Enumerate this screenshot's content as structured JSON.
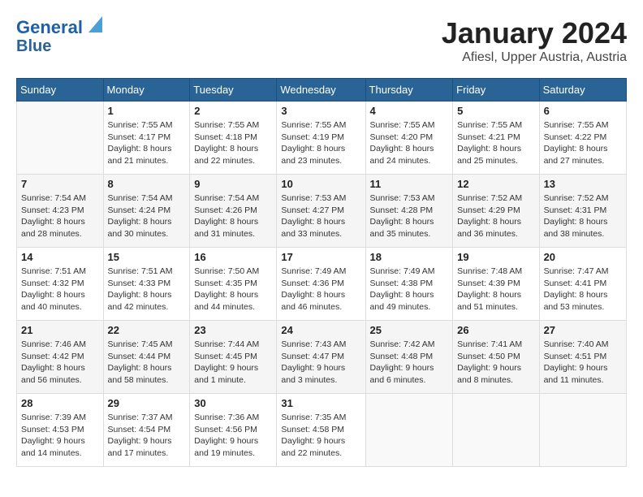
{
  "header": {
    "logo_general": "General",
    "logo_blue": "Blue",
    "month": "January 2024",
    "location": "Afiesl, Upper Austria, Austria"
  },
  "days_of_week": [
    "Sunday",
    "Monday",
    "Tuesday",
    "Wednesday",
    "Thursday",
    "Friday",
    "Saturday"
  ],
  "weeks": [
    [
      {
        "day": "",
        "sunrise": "",
        "sunset": "",
        "daylight": ""
      },
      {
        "day": "1",
        "sunrise": "Sunrise: 7:55 AM",
        "sunset": "Sunset: 4:17 PM",
        "daylight": "Daylight: 8 hours and 21 minutes."
      },
      {
        "day": "2",
        "sunrise": "Sunrise: 7:55 AM",
        "sunset": "Sunset: 4:18 PM",
        "daylight": "Daylight: 8 hours and 22 minutes."
      },
      {
        "day": "3",
        "sunrise": "Sunrise: 7:55 AM",
        "sunset": "Sunset: 4:19 PM",
        "daylight": "Daylight: 8 hours and 23 minutes."
      },
      {
        "day": "4",
        "sunrise": "Sunrise: 7:55 AM",
        "sunset": "Sunset: 4:20 PM",
        "daylight": "Daylight: 8 hours and 24 minutes."
      },
      {
        "day": "5",
        "sunrise": "Sunrise: 7:55 AM",
        "sunset": "Sunset: 4:21 PM",
        "daylight": "Daylight: 8 hours and 25 minutes."
      },
      {
        "day": "6",
        "sunrise": "Sunrise: 7:55 AM",
        "sunset": "Sunset: 4:22 PM",
        "daylight": "Daylight: 8 hours and 27 minutes."
      }
    ],
    [
      {
        "day": "7",
        "sunrise": "Sunrise: 7:54 AM",
        "sunset": "Sunset: 4:23 PM",
        "daylight": "Daylight: 8 hours and 28 minutes."
      },
      {
        "day": "8",
        "sunrise": "Sunrise: 7:54 AM",
        "sunset": "Sunset: 4:24 PM",
        "daylight": "Daylight: 8 hours and 30 minutes."
      },
      {
        "day": "9",
        "sunrise": "Sunrise: 7:54 AM",
        "sunset": "Sunset: 4:26 PM",
        "daylight": "Daylight: 8 hours and 31 minutes."
      },
      {
        "day": "10",
        "sunrise": "Sunrise: 7:53 AM",
        "sunset": "Sunset: 4:27 PM",
        "daylight": "Daylight: 8 hours and 33 minutes."
      },
      {
        "day": "11",
        "sunrise": "Sunrise: 7:53 AM",
        "sunset": "Sunset: 4:28 PM",
        "daylight": "Daylight: 8 hours and 35 minutes."
      },
      {
        "day": "12",
        "sunrise": "Sunrise: 7:52 AM",
        "sunset": "Sunset: 4:29 PM",
        "daylight": "Daylight: 8 hours and 36 minutes."
      },
      {
        "day": "13",
        "sunrise": "Sunrise: 7:52 AM",
        "sunset": "Sunset: 4:31 PM",
        "daylight": "Daylight: 8 hours and 38 minutes."
      }
    ],
    [
      {
        "day": "14",
        "sunrise": "Sunrise: 7:51 AM",
        "sunset": "Sunset: 4:32 PM",
        "daylight": "Daylight: 8 hours and 40 minutes."
      },
      {
        "day": "15",
        "sunrise": "Sunrise: 7:51 AM",
        "sunset": "Sunset: 4:33 PM",
        "daylight": "Daylight: 8 hours and 42 minutes."
      },
      {
        "day": "16",
        "sunrise": "Sunrise: 7:50 AM",
        "sunset": "Sunset: 4:35 PM",
        "daylight": "Daylight: 8 hours and 44 minutes."
      },
      {
        "day": "17",
        "sunrise": "Sunrise: 7:49 AM",
        "sunset": "Sunset: 4:36 PM",
        "daylight": "Daylight: 8 hours and 46 minutes."
      },
      {
        "day": "18",
        "sunrise": "Sunrise: 7:49 AM",
        "sunset": "Sunset: 4:38 PM",
        "daylight": "Daylight: 8 hours and 49 minutes."
      },
      {
        "day": "19",
        "sunrise": "Sunrise: 7:48 AM",
        "sunset": "Sunset: 4:39 PM",
        "daylight": "Daylight: 8 hours and 51 minutes."
      },
      {
        "day": "20",
        "sunrise": "Sunrise: 7:47 AM",
        "sunset": "Sunset: 4:41 PM",
        "daylight": "Daylight: 8 hours and 53 minutes."
      }
    ],
    [
      {
        "day": "21",
        "sunrise": "Sunrise: 7:46 AM",
        "sunset": "Sunset: 4:42 PM",
        "daylight": "Daylight: 8 hours and 56 minutes."
      },
      {
        "day": "22",
        "sunrise": "Sunrise: 7:45 AM",
        "sunset": "Sunset: 4:44 PM",
        "daylight": "Daylight: 8 hours and 58 minutes."
      },
      {
        "day": "23",
        "sunrise": "Sunrise: 7:44 AM",
        "sunset": "Sunset: 4:45 PM",
        "daylight": "Daylight: 9 hours and 1 minute."
      },
      {
        "day": "24",
        "sunrise": "Sunrise: 7:43 AM",
        "sunset": "Sunset: 4:47 PM",
        "daylight": "Daylight: 9 hours and 3 minutes."
      },
      {
        "day": "25",
        "sunrise": "Sunrise: 7:42 AM",
        "sunset": "Sunset: 4:48 PM",
        "daylight": "Daylight: 9 hours and 6 minutes."
      },
      {
        "day": "26",
        "sunrise": "Sunrise: 7:41 AM",
        "sunset": "Sunset: 4:50 PM",
        "daylight": "Daylight: 9 hours and 8 minutes."
      },
      {
        "day": "27",
        "sunrise": "Sunrise: 7:40 AM",
        "sunset": "Sunset: 4:51 PM",
        "daylight": "Daylight: 9 hours and 11 minutes."
      }
    ],
    [
      {
        "day": "28",
        "sunrise": "Sunrise: 7:39 AM",
        "sunset": "Sunset: 4:53 PM",
        "daylight": "Daylight: 9 hours and 14 minutes."
      },
      {
        "day": "29",
        "sunrise": "Sunrise: 7:37 AM",
        "sunset": "Sunset: 4:54 PM",
        "daylight": "Daylight: 9 hours and 17 minutes."
      },
      {
        "day": "30",
        "sunrise": "Sunrise: 7:36 AM",
        "sunset": "Sunset: 4:56 PM",
        "daylight": "Daylight: 9 hours and 19 minutes."
      },
      {
        "day": "31",
        "sunrise": "Sunrise: 7:35 AM",
        "sunset": "Sunset: 4:58 PM",
        "daylight": "Daylight: 9 hours and 22 minutes."
      },
      {
        "day": "",
        "sunrise": "",
        "sunset": "",
        "daylight": ""
      },
      {
        "day": "",
        "sunrise": "",
        "sunset": "",
        "daylight": ""
      },
      {
        "day": "",
        "sunrise": "",
        "sunset": "",
        "daylight": ""
      }
    ]
  ]
}
